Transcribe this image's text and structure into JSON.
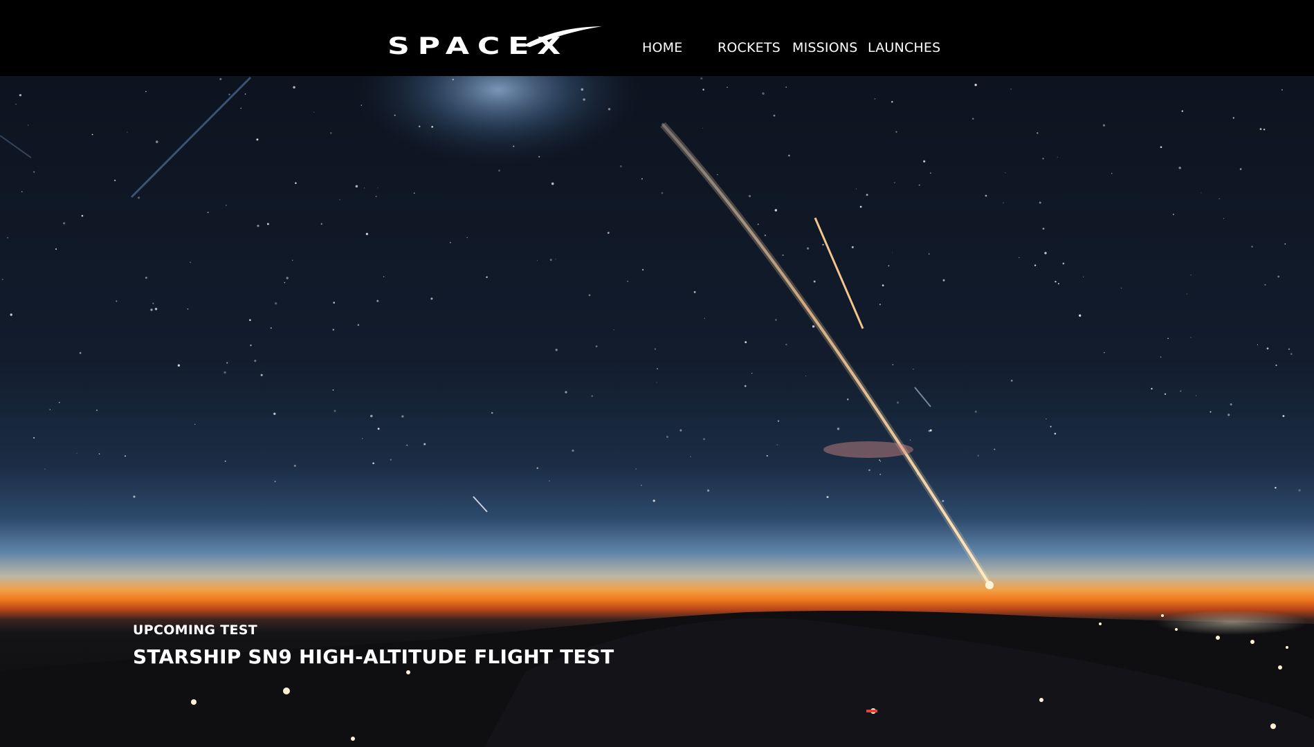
{
  "brand": {
    "logo_text": "SPACEX",
    "colors": {
      "header_background": "#000000",
      "nav_text": "#ffffff",
      "sky_top": "#0f1622",
      "horizon_orange": "#f07a1e"
    }
  },
  "nav": {
    "items": [
      {
        "label": "HOME"
      },
      {
        "label": "ROCKETS"
      },
      {
        "label": "MISSIONS"
      },
      {
        "label": "LAUNCHES"
      }
    ]
  },
  "hero": {
    "kicker": "UPCOMING TEST",
    "title": "STARSHIP SN9 HIGH-ALTITUDE FLIGHT TEST"
  }
}
